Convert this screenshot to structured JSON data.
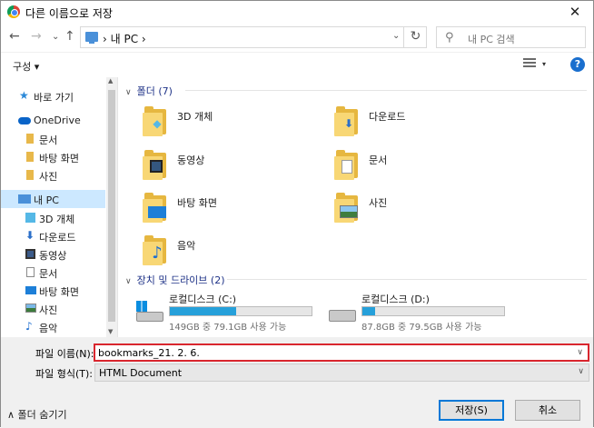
{
  "window": {
    "title": "다른 이름으로 저장",
    "close_glyph": "✕"
  },
  "nav": {
    "back": "←",
    "forward": "→",
    "down": "⌄",
    "up": "↑",
    "refresh": "↻",
    "path": "› 내 PC ›",
    "path_dropdown": "⌄",
    "search_placeholder": "내 PC 검색"
  },
  "toolbar": {
    "organize": "구성 ▾",
    "view_dropdown": "▾",
    "help": "?"
  },
  "sidebar": {
    "items": [
      {
        "label": "바로 가기",
        "icon": "star-icon"
      },
      {
        "label": "OneDrive",
        "icon": "cloud-icon"
      },
      {
        "label": "문서",
        "icon": "folder-icon"
      },
      {
        "label": "바탕 화면",
        "icon": "folder-icon"
      },
      {
        "label": "사진",
        "icon": "folder-icon"
      },
      {
        "label": "내 PC",
        "icon": "pc-icon"
      },
      {
        "label": "3D 개체",
        "icon": "cube-icon"
      },
      {
        "label": "다운로드",
        "icon": "download-icon"
      },
      {
        "label": "동영상",
        "icon": "video-icon"
      },
      {
        "label": "문서",
        "icon": "document-icon"
      },
      {
        "label": "바탕 화면",
        "icon": "desktop-icon"
      },
      {
        "label": "사진",
        "icon": "picture-icon"
      },
      {
        "label": "음악",
        "icon": "music-icon"
      }
    ]
  },
  "content": {
    "folders_header": "폴더 (7)",
    "folders": [
      {
        "label": "3D 개체",
        "icon": "cube-folder-icon"
      },
      {
        "label": "다운로드",
        "icon": "download-folder-icon"
      },
      {
        "label": "동영상",
        "icon": "video-folder-icon"
      },
      {
        "label": "문서",
        "icon": "document-folder-icon"
      },
      {
        "label": "바탕 화면",
        "icon": "desktop-folder-icon"
      },
      {
        "label": "사진",
        "icon": "picture-folder-icon"
      },
      {
        "label": "음악",
        "icon": "music-folder-icon"
      }
    ],
    "drives_header": "장치 및 드라이브 (2)",
    "drives": [
      {
        "name": "로컬디스크 (C:)",
        "info": "149GB 중 79.1GB 사용 가능",
        "used_fraction": 0.47,
        "icon": "windows-drive-icon"
      },
      {
        "name": "로컬디스크 (D:)",
        "info": "87.8GB 중 79.5GB 사용 가능",
        "used_fraction": 0.09,
        "icon": "drive-icon"
      }
    ]
  },
  "form": {
    "filename_label": "파일 이름(N):",
    "filename_value": "bookmarks_21. 2. 6.",
    "filetype_label": "파일 형식(T):",
    "filetype_value": "HTML Document",
    "hide_folders": "∧ 폴더 숨기기",
    "save": "저장(S)",
    "cancel": "취소"
  },
  "colors": {
    "accent": "#0078d7",
    "highlight_border": "#d9262e",
    "selection": "#cce8ff",
    "drive_fill": "#26a0da"
  }
}
